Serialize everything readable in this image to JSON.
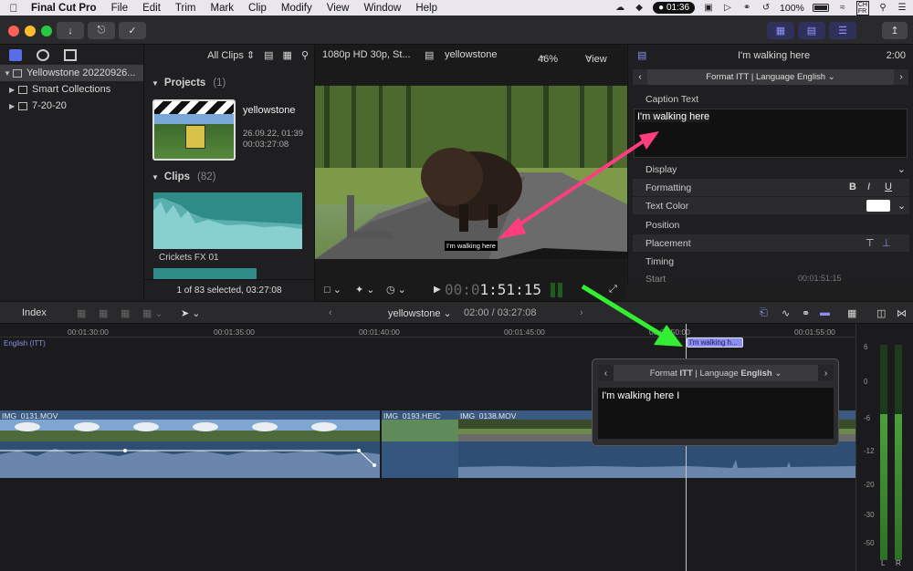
{
  "menubar": {
    "app_name": "Final Cut Pro",
    "items": [
      "File",
      "Edit",
      "Trim",
      "Mark",
      "Clip",
      "Modify",
      "View",
      "Window",
      "Help"
    ],
    "clock": "01:36",
    "battery": "100%",
    "user_badge_top": "CH",
    "user_badge_bottom": "FR"
  },
  "sidebar": {
    "library": "Yellowstone 20220926...",
    "items": [
      "Smart Collections",
      "7-20-20"
    ]
  },
  "browser": {
    "filter": "All Clips",
    "projects_label": "Projects",
    "projects_count": "(1)",
    "project": {
      "name": "yellowstone",
      "date": "26.09.22, 01:39",
      "duration": "00:03:27:08"
    },
    "clips_label": "Clips",
    "clips_count": "(82)",
    "clip_name": "Crickets FX 01",
    "footer": "1 of 83 selected, 03:27:08"
  },
  "viewer": {
    "format": "1080p HD 30p, St...",
    "project": "yellowstone",
    "zoom": "46%",
    "view_menu": "View",
    "caption_overlay": "I'm walking here",
    "timecode_dim": "00:0",
    "timecode": "1:51:15"
  },
  "inspector": {
    "title": "I'm walking here",
    "duration": "2:00",
    "format_prefix": "Format",
    "format_type": "ITT",
    "format_sep": "|",
    "format_lang_label": "Language",
    "format_lang": "English",
    "caption_text_label": "Caption Text",
    "caption_text": "I'm walking here",
    "display_label": "Display",
    "formatting_label": "Formatting",
    "text_color_label": "Text Color",
    "position_label": "Position",
    "placement_label": "Placement",
    "timing_label": "Timing",
    "start_label": "Start",
    "start_value": "00:01:51:15",
    "fmt_b": "B",
    "fmt_i": "I",
    "fmt_u": "U"
  },
  "timeline_bar": {
    "index": "Index",
    "project": "yellowstone",
    "position": "02:00 / 03:27:08"
  },
  "timeline": {
    "ruler_ticks": [
      "00:01:30:00",
      "00:01:35:00",
      "00:01:40:00",
      "00:01:45:00",
      "00:01:50:00",
      "00:01:55:00"
    ],
    "caption_lane": "English (ITT)",
    "caption_chip": "I'm walking h...",
    "clips": [
      "IMG_0131.MOV",
      "IMG_0193.HEIC",
      "IMG_0138.MOV"
    ]
  },
  "popup": {
    "format_prefix": "Format",
    "format_type": "ITT",
    "format_lang_label": "Language",
    "format_lang": "English",
    "text": "I'm walking here"
  },
  "meters": {
    "labels": [
      "6",
      "0",
      "-6",
      "-12",
      "-20",
      "-30",
      "-50"
    ],
    "left": "L",
    "right": "R"
  },
  "colors": {
    "accent": "#8b90f0",
    "pink_arrow": "#ff3d7f",
    "green_arrow": "#33ee33"
  }
}
